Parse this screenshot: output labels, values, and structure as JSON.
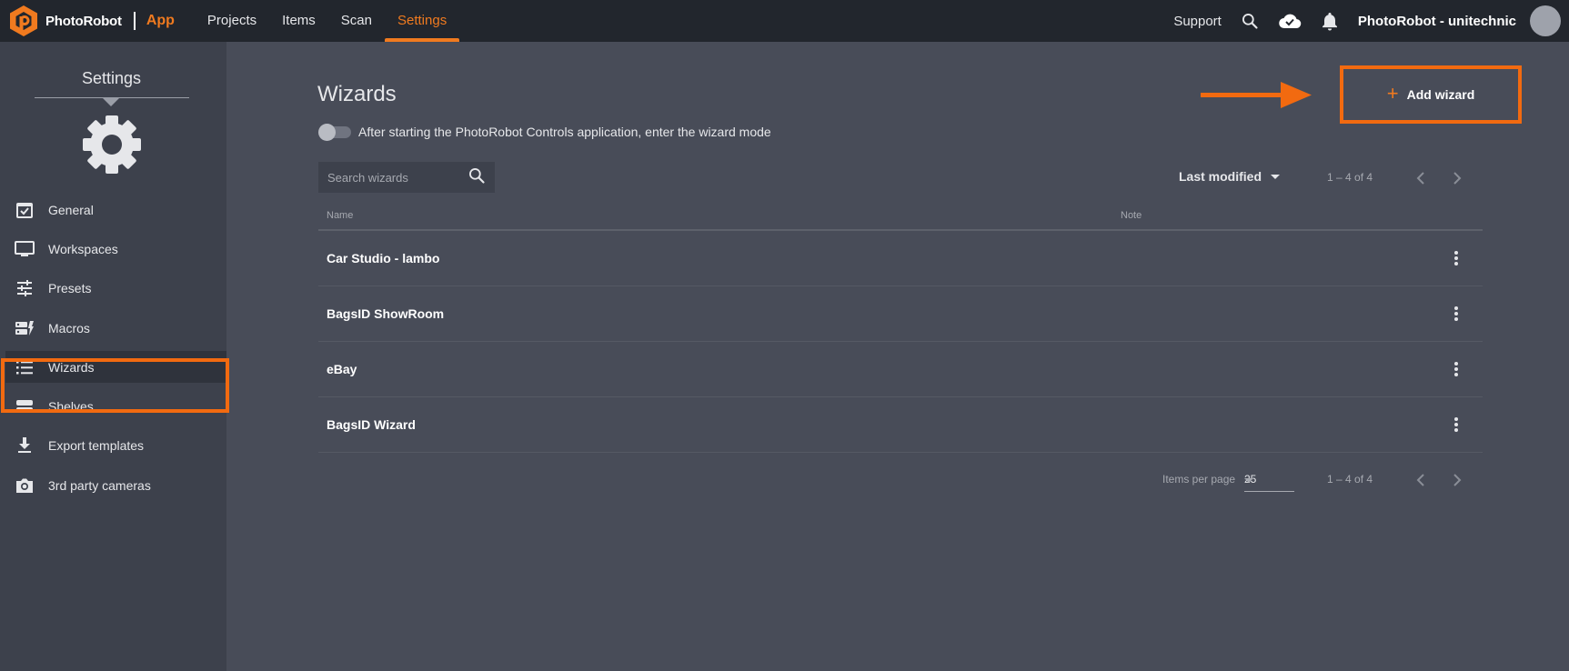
{
  "brand": {
    "name": "PhotoRobot",
    "app": "App",
    "logo_icon": "photorobot-hex-logo"
  },
  "nav": {
    "items": [
      {
        "label": "Projects",
        "active": false
      },
      {
        "label": "Items",
        "active": false
      },
      {
        "label": "Scan",
        "active": false
      },
      {
        "label": "Settings",
        "active": true
      }
    ]
  },
  "topbar": {
    "support_label": "Support",
    "icons": [
      "search-icon",
      "cloud-done-icon",
      "bell-icon"
    ],
    "account_name": "PhotoRobot - unitechnic"
  },
  "sidebar": {
    "title": "Settings",
    "header_icon": "gear-icon",
    "items": [
      {
        "label": "General",
        "icon": "checkbox-calendar-icon"
      },
      {
        "label": "Workspaces",
        "icon": "monitor-icon"
      },
      {
        "label": "Presets",
        "icon": "sliders-icon"
      },
      {
        "label": "Macros",
        "icon": "macro-icon"
      },
      {
        "label": "Wizards",
        "icon": "list-icon",
        "active": true
      },
      {
        "label": "Shelves",
        "icon": "storage-icon"
      },
      {
        "label": "Export templates",
        "icon": "download-icon"
      },
      {
        "label": "3rd party cameras",
        "icon": "camera-icon"
      }
    ]
  },
  "main": {
    "title": "Wizards",
    "toggle_label": "After starting the PhotoRobot Controls application, enter the wizard mode",
    "toggle_on": false,
    "search_placeholder": "Search wizards",
    "sort_label": "Last modified",
    "range_top": "1 – 4 of 4",
    "add_label": "Add wizard",
    "columns": {
      "name": "Name",
      "note": "Note"
    },
    "rows": [
      {
        "name": "Car Studio - lambo",
        "note": ""
      },
      {
        "name": "BagsID ShowRoom",
        "note": ""
      },
      {
        "name": "eBay",
        "note": ""
      },
      {
        "name": "BagsID Wizard",
        "note": ""
      }
    ],
    "items_per_page_label": "Items per page",
    "items_per_page_value": "25",
    "range_bottom": "1 – 4 of 4"
  },
  "colors": {
    "accent": "#f07a1f",
    "highlight": "#f26a10",
    "topbar": "#22262d",
    "sidebar": "#3d414c",
    "main": "#484c58"
  }
}
